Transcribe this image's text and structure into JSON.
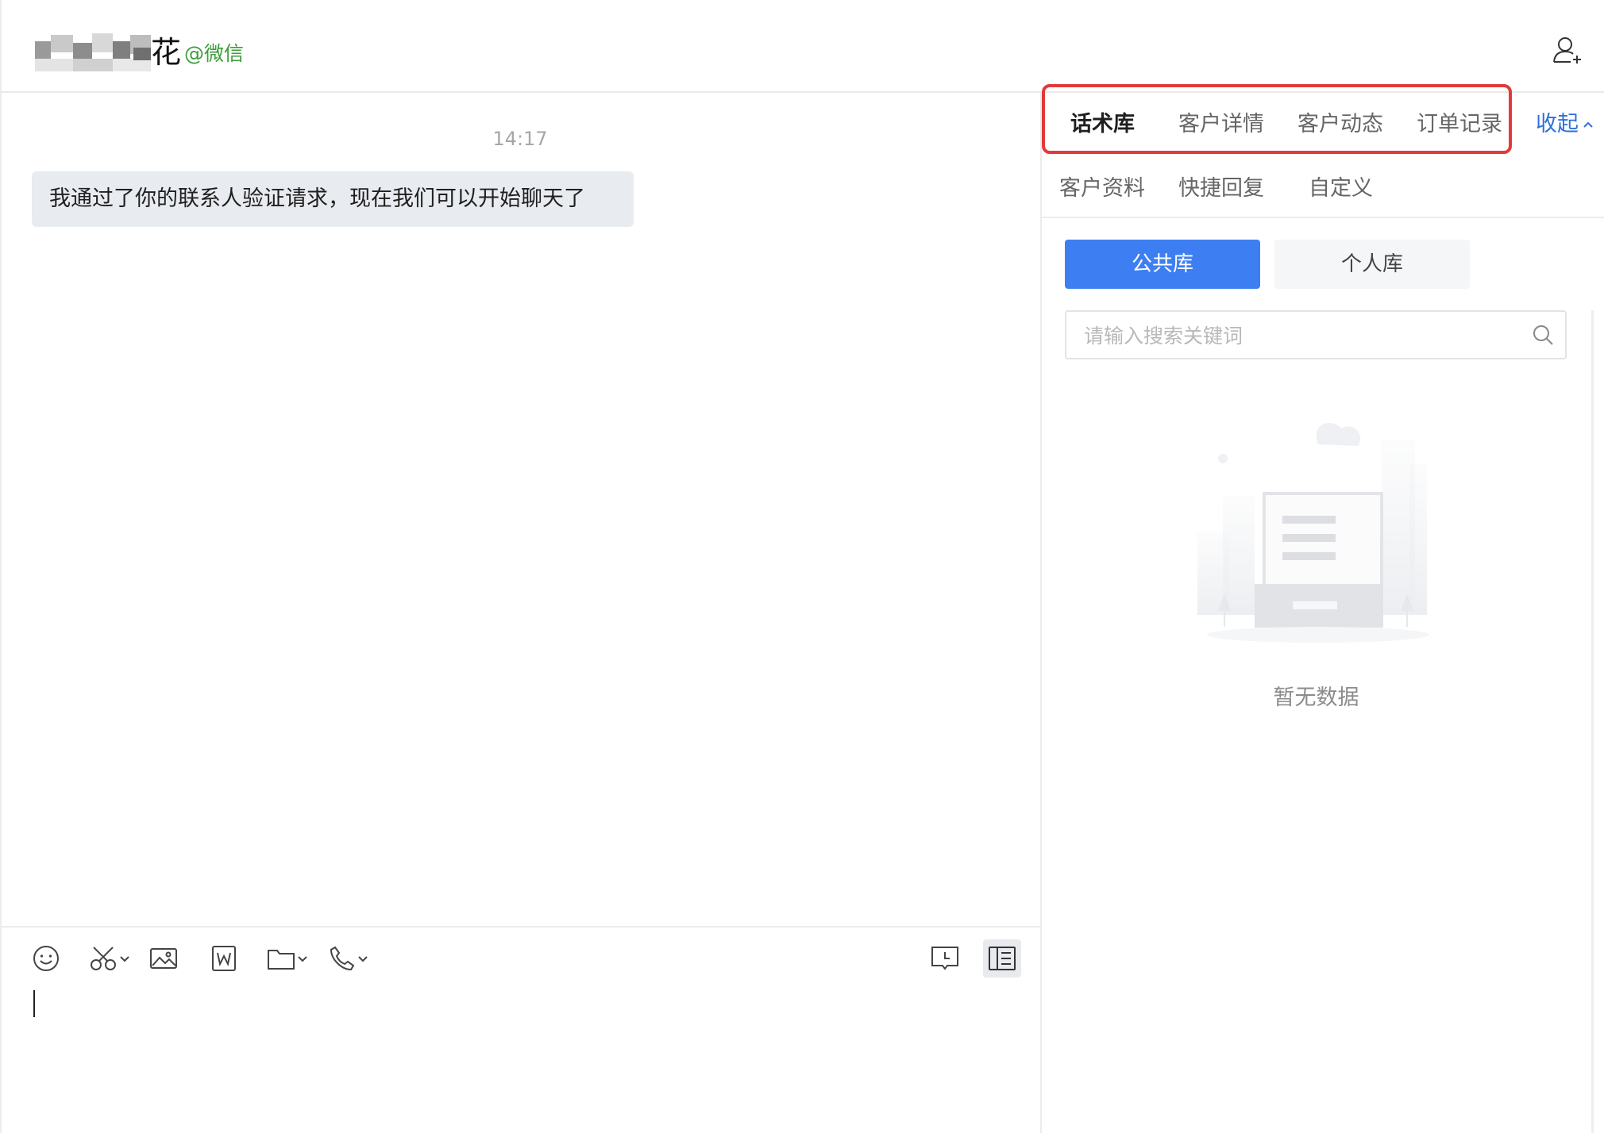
{
  "header": {
    "contact_name": "花",
    "channel": "@微信"
  },
  "chat": {
    "timestamp": "14:17",
    "message": "我通过了你的联系人验证请求，现在我们可以开始聊天了"
  },
  "panel": {
    "tabs": [
      {
        "label": "话术库",
        "active": true
      },
      {
        "label": "客户详情",
        "active": false
      },
      {
        "label": "客户动态",
        "active": false
      },
      {
        "label": "订单记录",
        "active": false
      }
    ],
    "collapse_label": "收起",
    "sub_tabs": [
      {
        "label": "客户资料"
      },
      {
        "label": "快捷回复"
      },
      {
        "label": "自定义"
      }
    ],
    "library_toggle": {
      "public": "公共库",
      "personal": "个人库"
    },
    "search_placeholder": "请输入搜索关键词",
    "empty_text": "暂无数据"
  },
  "toolbar": {
    "icons": [
      "emoji-icon",
      "scissors-icon",
      "image-icon",
      "word-doc-icon",
      "folder-icon",
      "phone-icon",
      "chat-history-icon",
      "sidebar-panel-icon"
    ]
  },
  "colors": {
    "accent": "#3d7ff2",
    "link": "#2f6fdb",
    "highlight_border": "#e23a3a",
    "channel_green": "#3a9e3a"
  }
}
